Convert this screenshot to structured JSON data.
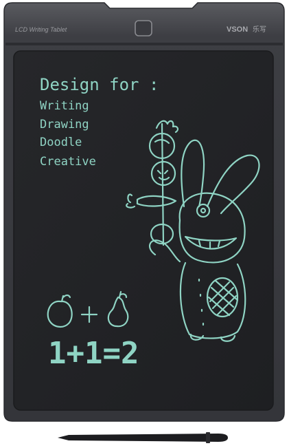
{
  "device": {
    "label_left": "LCD Writing Tablet",
    "brand_logo_text": "VSON",
    "brand_cjk": "乐写",
    "colors": {
      "frame": "#3a3b40",
      "frame_highlight": "#55565b",
      "screen": "#222326",
      "ink": "#8fd4c4",
      "stylus": "#1d1d20"
    }
  },
  "screen_text": {
    "heading": "Design for :",
    "items": [
      "Writing",
      "Drawing",
      "Doodle",
      "Creative"
    ],
    "equation": "1+1=2"
  },
  "drawing": {
    "subject": "rabbit holding fruit skewer",
    "fruits": "apple + pear"
  }
}
